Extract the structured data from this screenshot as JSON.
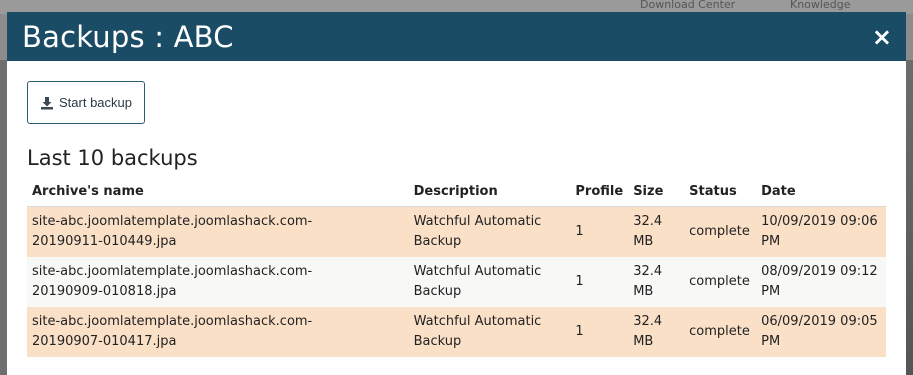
{
  "background": {
    "top_links": [
      "Download Center",
      "Knowledge"
    ]
  },
  "modal": {
    "title": "Backups : ABC",
    "close_label": "×",
    "start_backup_label": "Start backup",
    "section_title": "Last 10 backups",
    "columns": [
      "Archive's name",
      "Description",
      "Profile",
      "Size",
      "Status",
      "Date"
    ],
    "rows": [
      {
        "name_line1": "site-abc.joomlatemplate.joomlashack.com-",
        "name_line2": "20190911-010449.jpa",
        "desc_line1": "Watchful Automatic",
        "desc_line2": "Backup",
        "profile": "1",
        "size_line1": "32.4",
        "size_line2": "MB",
        "status": "complete",
        "date_line1": "10/09/2019 09:06",
        "date_line2": "PM"
      },
      {
        "name_line1": "site-abc.joomlatemplate.joomlashack.com-",
        "name_line2": "20190909-010818.jpa",
        "desc_line1": "Watchful Automatic",
        "desc_line2": "Backup",
        "profile": "1",
        "size_line1": "32.4",
        "size_line2": "MB",
        "status": "complete",
        "date_line1": "08/09/2019 09:12",
        "date_line2": "PM"
      },
      {
        "name_line1": "site-abc.joomlatemplate.joomlashack.com-",
        "name_line2": "20190907-010417.jpa",
        "desc_line1": "Watchful Automatic",
        "desc_line2": "Backup",
        "profile": "1",
        "size_line1": "32.4",
        "size_line2": "MB",
        "status": "complete",
        "date_line1": "06/09/2019 09:05",
        "date_line2": "PM"
      }
    ]
  },
  "colors": {
    "header_bg": "#1b4c66",
    "row_highlight": "#fbe0c8",
    "row_alt": "#f8f8f6"
  }
}
